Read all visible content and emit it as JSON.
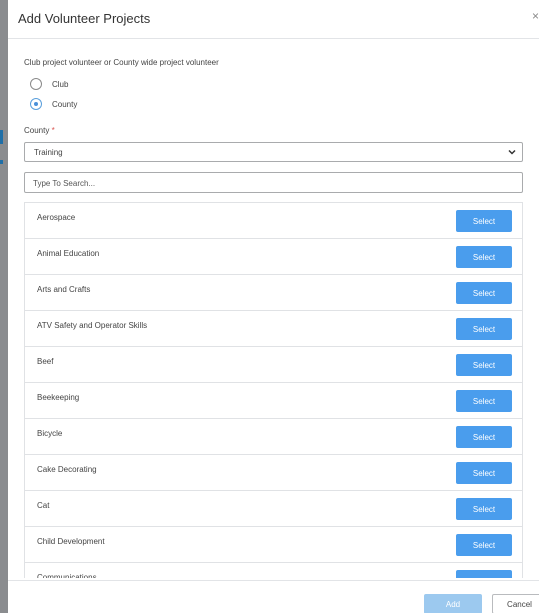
{
  "modal": {
    "title": "Add Volunteer Projects",
    "close_glyph": "×"
  },
  "form": {
    "question": "Club project volunteer or County wide project volunteer",
    "radio_options": [
      {
        "label": "Club",
        "checked": false
      },
      {
        "label": "County",
        "checked": true
      }
    ],
    "county_label": "County",
    "required_mark": "*",
    "county_selected": "Training",
    "search_placeholder": "Type To Search..."
  },
  "projects": {
    "button_label": "Select",
    "items": [
      "Aerospace",
      "Animal Education",
      "Arts and Crafts",
      "ATV Safety and Operator Skills",
      "Beef",
      "Beekeeping",
      "Bicycle",
      "Cake Decorating",
      "Cat",
      "Child Development",
      "Communications"
    ]
  },
  "footer": {
    "add_label": "Add",
    "cancel_label": "Cancel"
  },
  "colors": {
    "primary": "#4a9ded",
    "primary_disabled": "#9cc9ef",
    "required": "#d9534f"
  }
}
